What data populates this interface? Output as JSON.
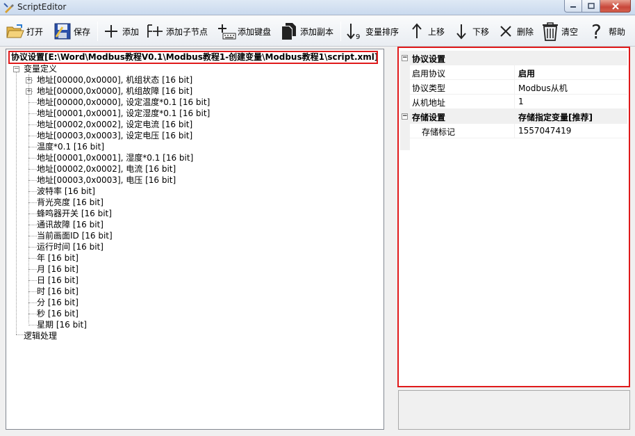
{
  "window": {
    "title": "ScriptEditor",
    "buttons": {
      "minimize": "minimize",
      "maximize": "maximize",
      "close": "close"
    }
  },
  "toolbar": {
    "open_label": "打开",
    "save_label": "保存",
    "add_label": "添加",
    "add_child_label": "添加子节点",
    "add_keyboard_label": "添加键盘",
    "add_copy_label": "添加副本",
    "sort_label": "变量排序",
    "move_up_label": "上移",
    "move_down_label": "下移",
    "delete_label": "删除",
    "clear_label": "清空",
    "help_label": "帮助"
  },
  "tree": {
    "root_label": "协议设置[E:\\Word\\Modbus教程V0.1\\Modbus教程1-创建变量\\Modbus教程1\\script.xml]",
    "variables_label": "变量定义",
    "items": [
      "地址[00000,0x0000], 机组状态 [16 bit]",
      "地址[00000,0x0000], 机组故障 [16 bit]",
      "地址[00000,0x0000], 设定温度*0.1 [16 bit]",
      "地址[00001,0x0001], 设定湿度*0.1 [16 bit]",
      "地址[00002,0x0002], 设定电流 [16 bit]",
      "地址[00003,0x0003], 设定电压 [16 bit]",
      "温度*0.1 [16 bit]",
      "地址[00001,0x0001], 湿度*0.1 [16 bit]",
      "地址[00002,0x0002], 电流 [16 bit]",
      "地址[00003,0x0003], 电压 [16 bit]",
      "波特率 [16 bit]",
      "背光亮度 [16 bit]",
      "蜂鸣器开关 [16 bit]",
      "通讯故障 [16 bit]",
      "当前画面ID [16 bit]",
      "运行时间 [16 bit]",
      "年 [16 bit]",
      "月 [16 bit]",
      "日 [16 bit]",
      "时 [16 bit]",
      "分 [16 bit]",
      "秒 [16 bit]",
      "星期 [16 bit]"
    ],
    "logic_label": "逻辑处理"
  },
  "properties": {
    "protocol_category": "协议设置",
    "rows": [
      {
        "name": "启用协议",
        "value": "启用"
      },
      {
        "name": "协议类型",
        "value": "Modbus从机"
      },
      {
        "name": "从机地址",
        "value": "1"
      }
    ],
    "storage_category": "存储设置",
    "storage_category_value": "存储指定变量[推荐]",
    "storage_rows": [
      {
        "name": "存储标记",
        "value": "1557047419"
      }
    ]
  },
  "colors": {
    "highlight_border": "#e0191a",
    "category_bg": "#f0f0f0"
  }
}
